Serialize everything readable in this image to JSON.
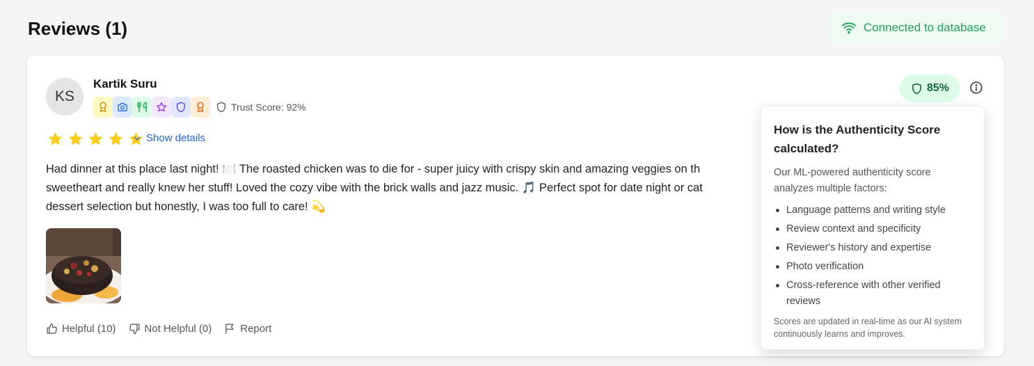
{
  "header": {
    "title": "Reviews (1)",
    "connection_status": "Connected to database",
    "connection_color": "#22a05a"
  },
  "review": {
    "reviewer": {
      "initials": "KS",
      "name": "Kartik Suru",
      "trust_score_label": "Trust Score: 92%",
      "badges": [
        {
          "icon": "award-icon",
          "bg": "#fef9c3",
          "color": "#ca8a04"
        },
        {
          "icon": "camera-icon",
          "bg": "#dbeafe",
          "color": "#2563eb"
        },
        {
          "icon": "utensils-icon",
          "bg": "#dcfce7",
          "color": "#16a34a"
        },
        {
          "icon": "star-outline-icon",
          "bg": "#f3e8ff",
          "color": "#9333ea"
        },
        {
          "icon": "shield-icon",
          "bg": "#e0e7ff",
          "color": "#4f46e5"
        },
        {
          "icon": "medal-icon",
          "bg": "#ffedd5",
          "color": "#ea580c"
        }
      ]
    },
    "rating": 5,
    "star_color": "#facc15",
    "show_details_label": "Show details",
    "text_lines": [
      "Had dinner at this place last night! 🍽️ The roasted chicken was to die for - super juicy with crispy skin and amazing veggies on th",
      "sweetheart and really knew her stuff! Loved the cozy vibe with the brick walls and jazz music. 🎵 Perfect spot for date night or cat",
      "dessert selection but honestly, I was too full to care! 💫"
    ],
    "authenticity_score": "85%",
    "actions": {
      "helpful": "Helpful (10)",
      "not_helpful": "Not Helpful (0)",
      "report": "Report"
    }
  },
  "authenticity_popover": {
    "title": "How is the Authenticity Score calculated?",
    "intro": "Our ML-powered authenticity score analyzes multiple factors:",
    "factors": [
      "Language patterns and writing style",
      "Review context and specificity",
      "Reviewer's history and expertise",
      "Photo verification",
      "Cross-reference with other verified reviews"
    ],
    "footer": "Scores are updated in real-time as our AI system continuously learns and improves."
  }
}
